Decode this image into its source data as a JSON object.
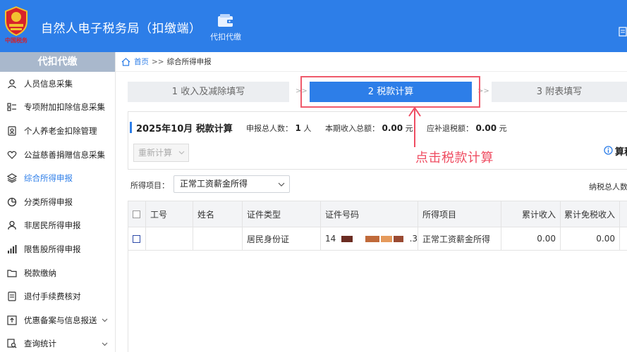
{
  "header": {
    "emblem_text": "中国税务",
    "app_title": "自然人电子税务局（扣缴端）",
    "module_label": "代扣代缴"
  },
  "sidebar": {
    "title": "代扣代缴",
    "items": [
      {
        "label": "人员信息采集",
        "icon": "person-icon"
      },
      {
        "label": "专项附加扣除信息采集",
        "icon": "list-icon"
      },
      {
        "label": "个人养老金扣除管理",
        "icon": "pension-icon"
      },
      {
        "label": "公益慈善捐赠信息采集",
        "icon": "heart-icon"
      },
      {
        "label": "综合所得申报",
        "icon": "layers-icon",
        "active": true
      },
      {
        "label": "分类所得申报",
        "icon": "pie-icon"
      },
      {
        "label": "非居民所得申报",
        "icon": "user-icon"
      },
      {
        "label": "限售股所得申报",
        "icon": "bar-chart-icon"
      },
      {
        "label": "税款缴纳",
        "icon": "folder-icon"
      },
      {
        "label": "退付手续费核对",
        "icon": "document-icon"
      },
      {
        "label": "优惠备案与信息报送",
        "icon": "upload-icon",
        "expandable": true
      },
      {
        "label": "查询统计",
        "icon": "search-doc-icon",
        "expandable": true
      }
    ]
  },
  "breadcrumb": {
    "home": "首页",
    "separator": ">>",
    "current": "综合所得申报"
  },
  "steps": [
    {
      "label": "1 收入及减除填写"
    },
    {
      "label": "2 税款计算",
      "active": true
    },
    {
      "label": "3 附表填写"
    }
  ],
  "step_separator": ">>",
  "summary": {
    "title": "2025年10月  税款计算",
    "declarants_label": "申报总人数：",
    "declarants_value": "1",
    "declarants_unit": "人",
    "income_label": "本期收入总额：",
    "income_value": "0.00",
    "income_unit": "元",
    "tax_label": "应补退税额：",
    "tax_value": "0.00",
    "tax_unit": "元",
    "recalc_label": "重新计算",
    "info_text": "算税"
  },
  "annotation": "点击税款计算",
  "filter": {
    "label": "所得项目：",
    "value": "正常工资薪金所得",
    "right_label": "纳税总人数"
  },
  "table": {
    "columns": [
      "工号",
      "姓名",
      "证件类型",
      "证件号码",
      "所得项目",
      "累计收入",
      "累计免税收入"
    ],
    "rows": [
      {
        "employee_id": "",
        "name": "",
        "id_type": "居民身份证",
        "id_prefix": "14",
        "id_suffix": ".3",
        "income_item": "正常工资薪金所得",
        "cumulative_income": "0.00",
        "cumulative_exempt": "0.00"
      }
    ]
  },
  "colors": {
    "header_bg": "#2d7ee8",
    "accent": "#2d7ee8",
    "annotation": "#ef4d62",
    "sidebar_head": "#a9b8cc"
  }
}
